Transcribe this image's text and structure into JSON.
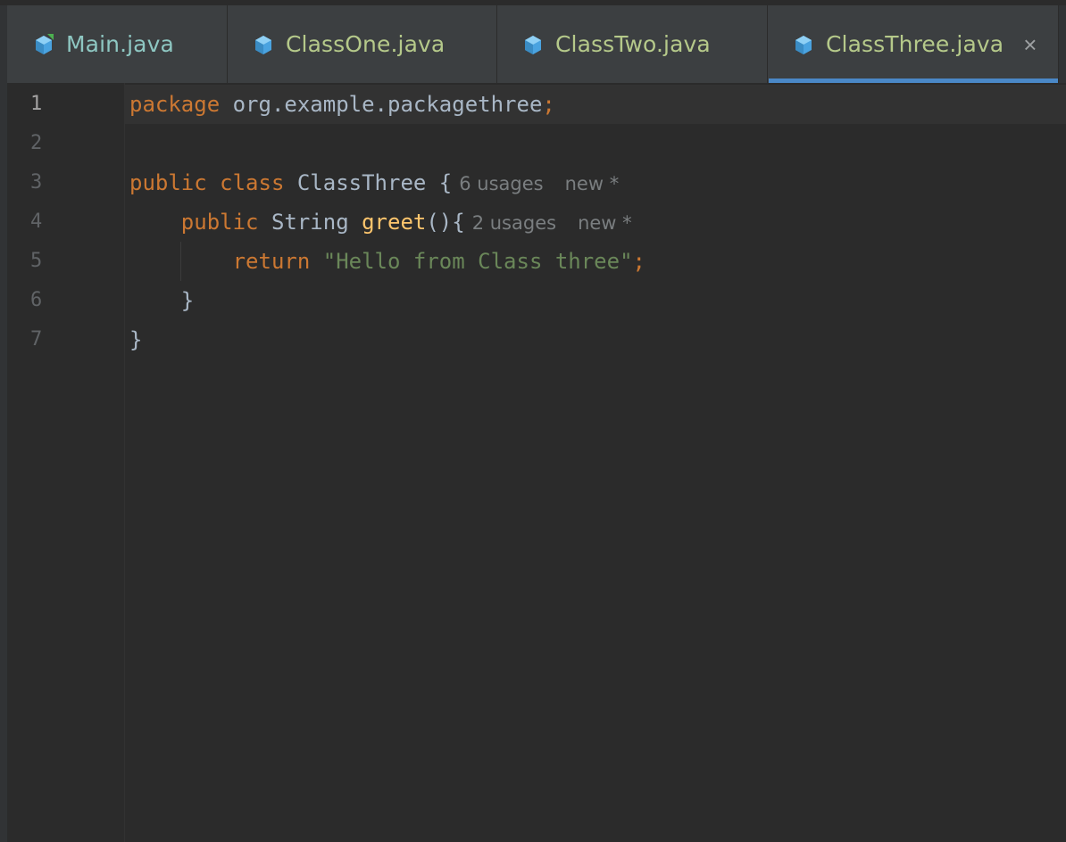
{
  "tabs": [
    {
      "label": "Main.java",
      "icon": "java-class-main-icon"
    },
    {
      "label": "ClassOne.java",
      "icon": "java-class-icon"
    },
    {
      "label": "ClassTwo.java",
      "icon": "java-class-icon"
    },
    {
      "label": "ClassThree.java",
      "icon": "java-class-icon",
      "active": true,
      "close": "×"
    }
  ],
  "colors": {
    "keyword": "#cc7832",
    "string": "#6a8759",
    "method": "#ffc66d",
    "text": "#a9b7c6",
    "accent": "#4a88c7",
    "icon": "#4aa3e0"
  },
  "line_numbers": [
    "1",
    "2",
    "3",
    "4",
    "5",
    "6",
    "7"
  ],
  "code": {
    "line1": {
      "kw": "package",
      "rest": " org.example.packagethree",
      "semi": ";"
    },
    "line3": {
      "kw1": "public",
      "kw2": "class",
      "name": " ClassThree {",
      "hint_usages": "6 usages",
      "hint_new": "new *"
    },
    "line4": {
      "kw": "public",
      "type": " String ",
      "fn": "greet",
      "rest": "(){",
      "hint_usages": "2 usages",
      "hint_new": "new *"
    },
    "line5": {
      "kw": "return",
      "str": "\"Hello from Class three\"",
      "semi": ";"
    },
    "line6": {
      "text": "}"
    },
    "line7": {
      "text": "}"
    }
  }
}
